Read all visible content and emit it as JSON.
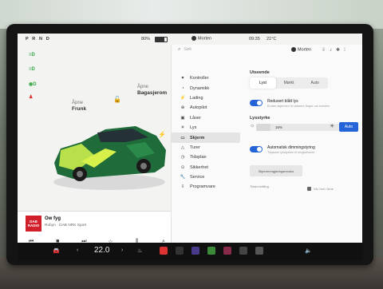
{
  "status": {
    "gear": "P R N D",
    "battery_pct": "80%",
    "profile": "Morten",
    "time": "09:35",
    "temp": "21°C"
  },
  "vehicle": {
    "indicators": [
      "≡D",
      "≡D",
      "◉D"
    ],
    "frunk": {
      "line1": "Åpne",
      "line2": "Frunk"
    },
    "trunk": {
      "line1": "Åpne",
      "line2": "Bagasjerom"
    }
  },
  "media": {
    "art_label": "DAB RADIO",
    "title": "Ow fyg",
    "subtitle": "Robyn · DAB NRK Sport"
  },
  "settings": {
    "search_placeholder": "Søk",
    "user": "Morten",
    "menu": [
      {
        "icon": "♥",
        "label": "Kontroller",
        "active": false
      },
      {
        "icon": "◔",
        "label": "Dynamikk",
        "active": false
      },
      {
        "icon": "⚡",
        "label": "Lading",
        "active": false
      },
      {
        "icon": "⊕",
        "label": "Autopilot",
        "active": false
      },
      {
        "icon": "▣",
        "label": "Låser",
        "active": false
      },
      {
        "icon": "☀",
        "label": "Lys",
        "active": false
      },
      {
        "icon": "▭",
        "label": "Skjerm",
        "active": true
      },
      {
        "icon": "△",
        "label": "Turer",
        "active": false
      },
      {
        "icon": "◷",
        "label": "Tidsplan",
        "active": false
      },
      {
        "icon": "⊙",
        "label": "Sikkerhet",
        "active": false
      },
      {
        "icon": "🔧",
        "label": "Service",
        "active": false
      },
      {
        "icon": "⇩",
        "label": "Programvare",
        "active": false
      }
    ],
    "appearance": {
      "heading": "Utseende",
      "options": [
        "Lyst",
        "Mørkt",
        "Auto"
      ],
      "selected": "Lyst"
    },
    "toggle1": {
      "title": "Redusert blått lys",
      "desc": "Endrer skjermen til varmere farger om kvelden",
      "on": true
    },
    "brightness": {
      "heading": "Lysstyrke",
      "value": "16%",
      "level": 0.16,
      "auto_label": "Auto"
    },
    "toggle2": {
      "title": "Automatisk dimmingstyring",
      "desc": "Tilpasser lysstyrken til omgivelsene",
      "on": true
    },
    "button_label": "Skjermrengjøringsmodus",
    "footer_left": "Tidsinnstilling",
    "footer_right": "Vis i km / time"
  },
  "dock": {
    "temperature": "22.0"
  }
}
